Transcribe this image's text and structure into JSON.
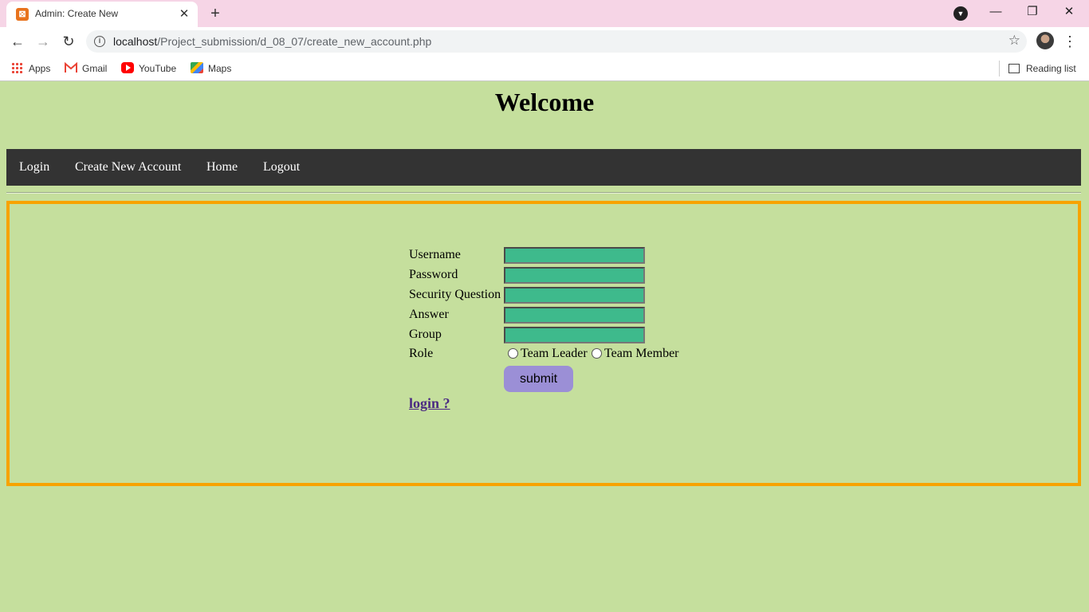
{
  "browser": {
    "tab_title": "Admin: Create New",
    "url_host": "localhost",
    "url_path": "/Project_submission/d_08_07/create_new_account.php",
    "bookmarks": [
      {
        "label": "Apps",
        "icon": "apps-icon"
      },
      {
        "label": "Gmail",
        "icon": "gmail-icon"
      },
      {
        "label": "YouTube",
        "icon": "youtube-icon"
      },
      {
        "label": "Maps",
        "icon": "maps-icon"
      }
    ],
    "reading_list_label": "Reading list",
    "colors": {
      "tab_strip": "#f6d5e6",
      "toolbar": "#ffffff"
    }
  },
  "page": {
    "title": "Welcome",
    "nav": [
      "Login",
      "Create New Account",
      "Home",
      "Logout"
    ],
    "form": {
      "fields": [
        {
          "label": "Username",
          "value": ""
        },
        {
          "label": "Password",
          "value": ""
        },
        {
          "label": "Security Question",
          "value": ""
        },
        {
          "label": "Answer",
          "value": ""
        },
        {
          "label": "Group",
          "value": ""
        }
      ],
      "role_label": "Role",
      "role_options": [
        "Team Leader",
        "Team Member"
      ],
      "submit_label": "submit"
    },
    "login_link": "login ?",
    "colors": {
      "background": "#c5df9d",
      "navbar": "#333333",
      "panel_border": "#f7a300",
      "input_fill": "#3eba8c",
      "submit_fill": "#9b8fd6",
      "link": "#4b2a82"
    }
  }
}
